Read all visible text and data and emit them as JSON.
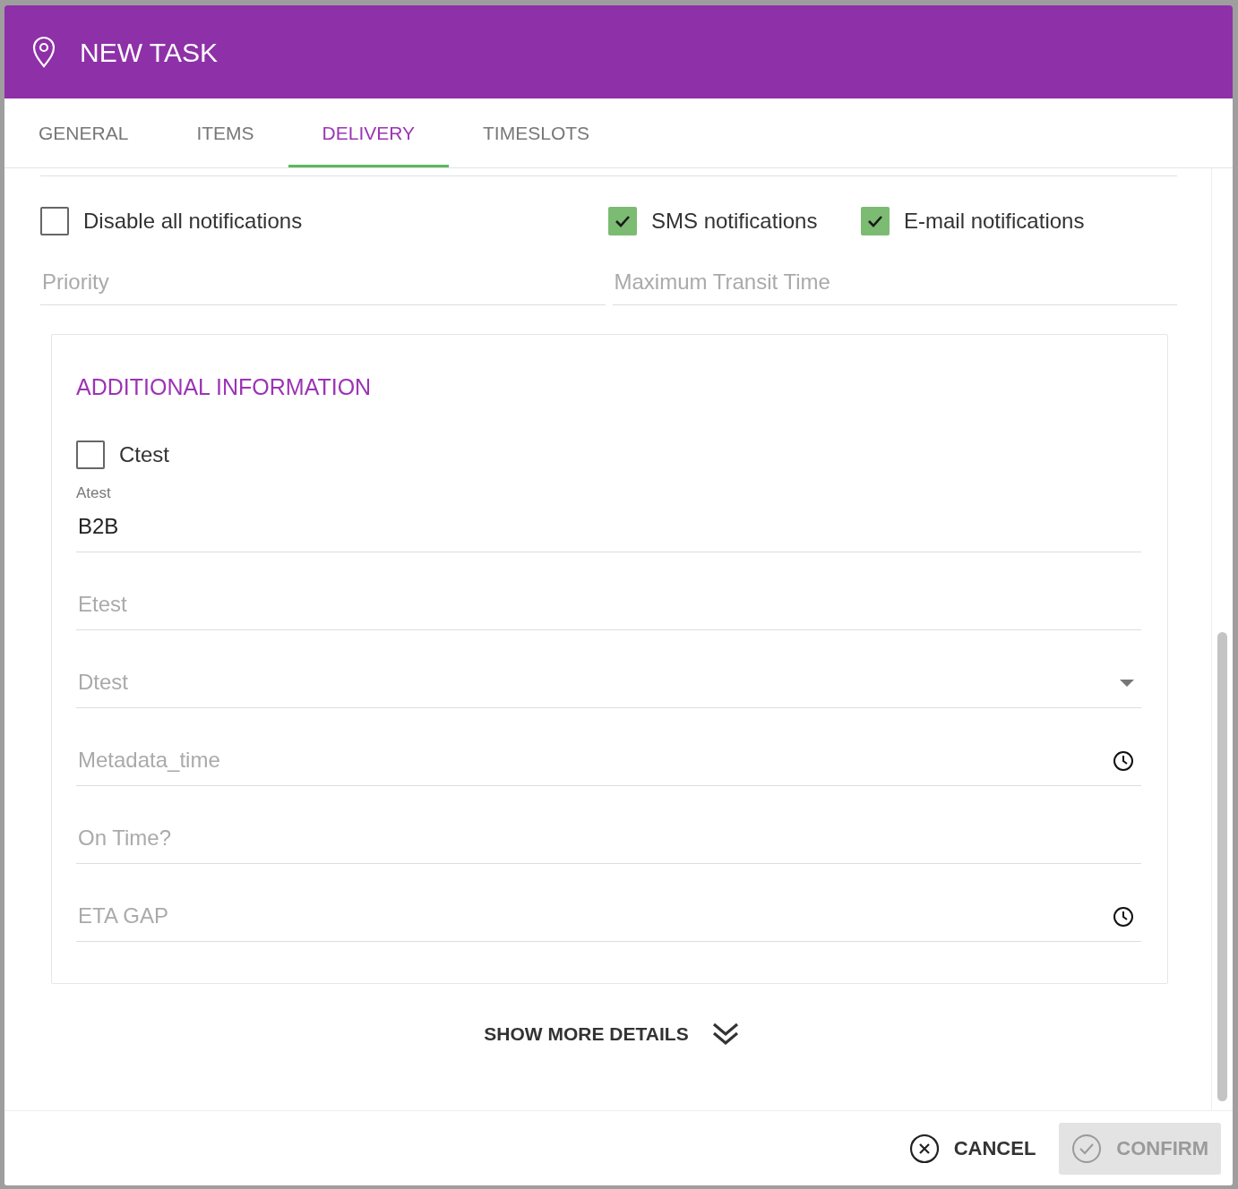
{
  "dialog": {
    "title": "NEW TASK"
  },
  "tabs": [
    {
      "label": "GENERAL",
      "selected": false
    },
    {
      "label": "ITEMS",
      "selected": false
    },
    {
      "label": "DELIVERY",
      "selected": true
    },
    {
      "label": "TIMESLOTS",
      "selected": false
    }
  ],
  "notifications": [
    {
      "label": "Disable all notifications",
      "checked": false
    },
    {
      "label": "SMS notifications",
      "checked": true
    },
    {
      "label": "E-mail notifications",
      "checked": true
    }
  ],
  "top_fields": [
    {
      "placeholder": "Priority"
    },
    {
      "placeholder": "Maximum Transit Time"
    }
  ],
  "additional_information": {
    "title": "ADDITIONAL INFORMATION",
    "checkbox": {
      "label": "Ctest",
      "checked": false
    },
    "fields": [
      {
        "kind": "text",
        "label": "Atest",
        "value": "B2B"
      },
      {
        "kind": "text",
        "placeholder": "Etest"
      },
      {
        "kind": "select",
        "placeholder": "Dtest"
      },
      {
        "kind": "time",
        "placeholder": "Metadata_time"
      },
      {
        "kind": "text",
        "placeholder": "On Time?"
      },
      {
        "kind": "time",
        "placeholder": "ETA GAP"
      }
    ]
  },
  "show_more": "SHOW MORE DETAILS",
  "footer": {
    "cancel": "CANCEL",
    "confirm": {
      "label": "CONFIRM",
      "disabled": true
    }
  }
}
